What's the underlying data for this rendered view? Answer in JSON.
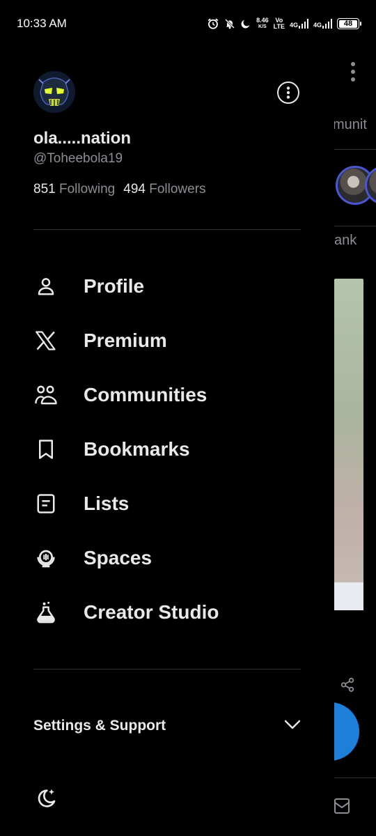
{
  "status_bar": {
    "time": "10:33 AM",
    "net_speed_value": "8.46",
    "net_speed_unit": "K/S",
    "volte_top": "Vo",
    "volte_bottom": "LTE",
    "network_1": "4G",
    "network_2": "4G",
    "battery": "48",
    "icons": [
      "alarm-icon",
      "mute-icon",
      "do-not-disturb-icon",
      "signal-icon",
      "battery-icon"
    ]
  },
  "background": {
    "peek_text_1": "munit",
    "peek_text_2": "ank"
  },
  "profile": {
    "display_name": "ola.....nation",
    "handle": "@Toheebola19",
    "following_count": "851",
    "following_label": "Following",
    "followers_count": "494",
    "followers_label": "Followers"
  },
  "menu": [
    {
      "label": "Profile",
      "icon": "person-icon"
    },
    {
      "label": "Premium",
      "icon": "x-logo-icon"
    },
    {
      "label": "Communities",
      "icon": "communities-icon"
    },
    {
      "label": "Bookmarks",
      "icon": "bookmark-icon"
    },
    {
      "label": "Lists",
      "icon": "list-icon"
    },
    {
      "label": "Spaces",
      "icon": "spaces-icon"
    },
    {
      "label": "Creator Studio",
      "icon": "flask-icon"
    }
  ],
  "settings": {
    "label": "Settings & Support"
  },
  "colors": {
    "background": "#000000",
    "text_primary": "#e7e9ea",
    "text_secondary": "#8b8f93",
    "divider": "#2f3336",
    "accent": "#1d7fd8"
  }
}
